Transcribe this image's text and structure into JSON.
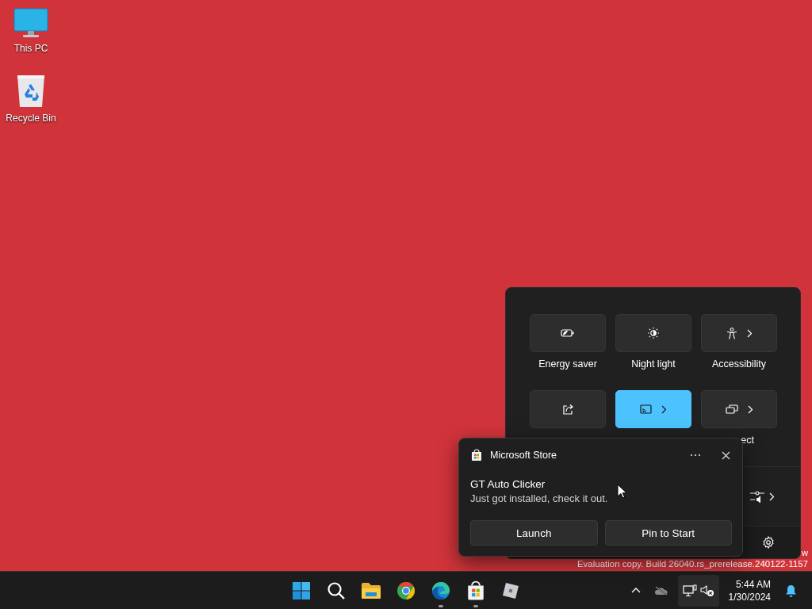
{
  "desktop": {
    "icons": [
      {
        "label": "This PC",
        "kind": "computer"
      },
      {
        "label": "Recycle Bin",
        "kind": "bin"
      }
    ]
  },
  "quick_settings": {
    "tiles": [
      {
        "label": "Energy saver",
        "kind": "energy",
        "on": false,
        "chevron": false
      },
      {
        "label": "Night light",
        "kind": "night",
        "on": false,
        "chevron": false
      },
      {
        "label": "Accessibility",
        "kind": "accessibility",
        "on": false,
        "chevron": true
      },
      {
        "kind": "share",
        "on": false,
        "chevron": false
      },
      {
        "kind": "cast",
        "on": true,
        "chevron": true
      },
      {
        "label": "ect",
        "kind": "project",
        "on": false,
        "chevron": true
      }
    ]
  },
  "notification": {
    "app": "Microsoft Store",
    "title": "GT Auto Clicker",
    "message": "Just got installed, check it out.",
    "buttons": [
      "Launch",
      "Pin to Start"
    ]
  },
  "watermark": [
    "w",
    "Evaluation copy. Build 26040.rs_prerelease.240122-1157"
  ],
  "taskbar": {
    "apps": [
      {
        "kind": "start",
        "running": false
      },
      {
        "kind": "search",
        "running": false
      },
      {
        "kind": "folder",
        "running": false
      },
      {
        "kind": "chrome",
        "running": false
      },
      {
        "kind": "edge",
        "running": true
      },
      {
        "kind": "store",
        "running": true
      },
      {
        "kind": "cube",
        "running": false
      }
    ],
    "time": "5:44 AM",
    "date": "1/30/2024"
  }
}
